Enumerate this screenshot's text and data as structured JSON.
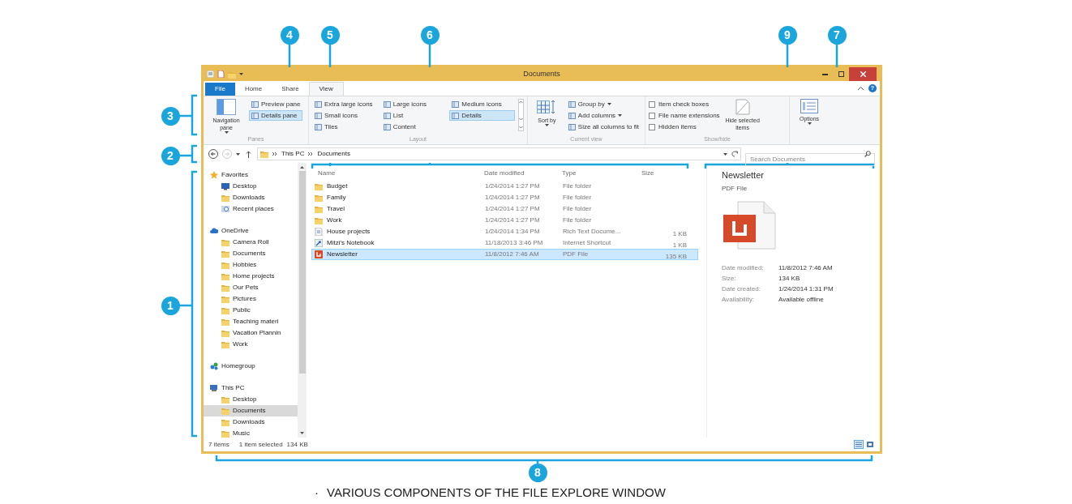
{
  "callouts": [
    {
      "number": "4"
    },
    {
      "number": "5"
    },
    {
      "number": "6"
    },
    {
      "number": "9"
    },
    {
      "number": "7"
    },
    {
      "number": "3"
    },
    {
      "number": "2"
    },
    {
      "number": "1"
    },
    {
      "number": "8"
    }
  ],
  "window": {
    "title": "Documents",
    "help": "?",
    "tabs": [
      {
        "label": "File",
        "kind": "file",
        "selected": false
      },
      {
        "label": "Home",
        "kind": "tab",
        "selected": false
      },
      {
        "label": "Share",
        "kind": "tab",
        "selected": false
      },
      {
        "label": "View",
        "kind": "tab",
        "selected": true
      }
    ],
    "ribbon": {
      "panes": {
        "label": "Panes",
        "big_button": "Navigation pane",
        "buttons": [
          {
            "label": "Preview pane",
            "selected": false
          },
          {
            "label": "Details pane",
            "selected": true
          }
        ]
      },
      "layout": {
        "label": "Layout",
        "options": [
          {
            "label": "Extra large icons",
            "selected": false
          },
          {
            "label": "Large icons",
            "selected": false
          },
          {
            "label": "Medium icons",
            "selected": false
          },
          {
            "label": "Small icons",
            "selected": false
          },
          {
            "label": "List",
            "selected": false
          },
          {
            "label": "Details",
            "selected": true
          },
          {
            "label": "Tiles",
            "selected": false
          },
          {
            "label": "Content",
            "selected": false
          }
        ]
      },
      "current_view": {
        "label": "Current view",
        "big_button": "Sort by",
        "buttons": [
          {
            "label": "Group by",
            "dropdown": true
          },
          {
            "label": "Add columns",
            "dropdown": true
          },
          {
            "label": "Size all columns to fit",
            "dropdown": false
          }
        ]
      },
      "show_hide": {
        "label": "Show/hide",
        "checkboxes": [
          {
            "label": "Item check boxes",
            "checked": false
          },
          {
            "label": "File name extensions",
            "checked": false
          },
          {
            "label": "Hidden items",
            "checked": false
          }
        ],
        "big_button": "Hide selected items"
      },
      "options": {
        "label": "Options"
      }
    },
    "address": {
      "path": [
        "This PC",
        "Documents"
      ],
      "search_placeholder": "Search Documents"
    },
    "navigation": [
      {
        "label": "Favorites",
        "kind": "star",
        "selected": false,
        "children": [
          {
            "label": "Desktop",
            "kind": "desktop",
            "selected": false
          },
          {
            "label": "Downloads",
            "kind": "folder",
            "selected": false
          },
          {
            "label": "Recent places",
            "kind": "clock",
            "selected": false
          }
        ]
      },
      {
        "label": "OneDrive",
        "kind": "cloud",
        "selected": false,
        "children": [
          {
            "label": "Camera Roll",
            "kind": "folder",
            "selected": false
          },
          {
            "label": "Documents",
            "kind": "folder",
            "selected": false
          },
          {
            "label": "Hobbies",
            "kind": "folder",
            "selected": false
          },
          {
            "label": "Home projects",
            "kind": "folder",
            "selected": false
          },
          {
            "label": "Our Pets",
            "kind": "folder",
            "selected": false
          },
          {
            "label": "Pictures",
            "kind": "folder",
            "selected": false
          },
          {
            "label": "Public",
            "kind": "folder",
            "selected": false
          },
          {
            "label": "Teaching materi",
            "kind": "folder",
            "selected": false
          },
          {
            "label": "Vacation Plannin",
            "kind": "folder",
            "selected": false
          },
          {
            "label": "Work",
            "kind": "folder",
            "selected": false
          }
        ]
      },
      {
        "label": "Homegroup",
        "kind": "network",
        "selected": false
      },
      {
        "label": "This PC",
        "kind": "computer",
        "selected": false,
        "children": [
          {
            "label": "Desktop",
            "kind": "folder",
            "selected": false
          },
          {
            "label": "Documents",
            "kind": "folder",
            "selected": true
          },
          {
            "label": "Downloads",
            "kind": "folder",
            "selected": false
          },
          {
            "label": "Music",
            "kind": "folder",
            "selected": false
          }
        ]
      }
    ],
    "file_list": {
      "columns": [
        "Name",
        "Date modified",
        "Type",
        "Size"
      ],
      "rows": [
        {
          "kind": "folder",
          "name": "Budget",
          "date": "1/24/2014 1:27 PM",
          "type": "File folder",
          "selected": false
        },
        {
          "kind": "folder",
          "name": "Family",
          "date": "1/24/2014 1:27 PM",
          "type": "File folder",
          "selected": false
        },
        {
          "kind": "folder",
          "name": "Travel",
          "date": "1/24/2014 1:27 PM",
          "type": "File folder",
          "selected": false
        },
        {
          "kind": "folder",
          "name": "Work",
          "date": "1/24/2014 1:27 PM",
          "type": "File folder",
          "selected": false
        },
        {
          "kind": "document",
          "name": "House projects",
          "date": "1/24/2014 1:34 PM",
          "type": "Rich Text Docume...",
          "size": "1 KB",
          "selected": false
        },
        {
          "kind": "shortcut",
          "name": "Mitzi's Notebook",
          "date": "11/18/2013 3:46 PM",
          "type": "Internet Shortcut",
          "size": "1 KB",
          "selected": false
        },
        {
          "kind": "pdf",
          "name": "Newsletter",
          "date": "11/8/2012 7:46 AM",
          "type": "PDF File",
          "size": "135 KB",
          "selected": true
        }
      ]
    },
    "details_pane": {
      "title": "Newsletter",
      "subtitle": "PDF File",
      "properties": [
        {
          "label": "Date modified:",
          "value": "11/8/2012 7:46 AM"
        },
        {
          "label": "Size:",
          "value": "134 KB"
        },
        {
          "label": "Date created:",
          "value": "1/24/2014 1:31 PM"
        },
        {
          "label": "Availability:",
          "value": "Available offline"
        }
      ]
    },
    "status_bar": {
      "item_count": "7 items",
      "selection": "1 item selected",
      "selection_size": "134 KB",
      "view_buttons": [
        {
          "kind": "details",
          "selected": true
        },
        {
          "kind": "large_icons",
          "selected": false
        }
      ]
    }
  },
  "caption": {
    "bullet": "·",
    "text": "VARIOUS COMPONENTS OF THE FILE EXPLORE WINDOW"
  }
}
